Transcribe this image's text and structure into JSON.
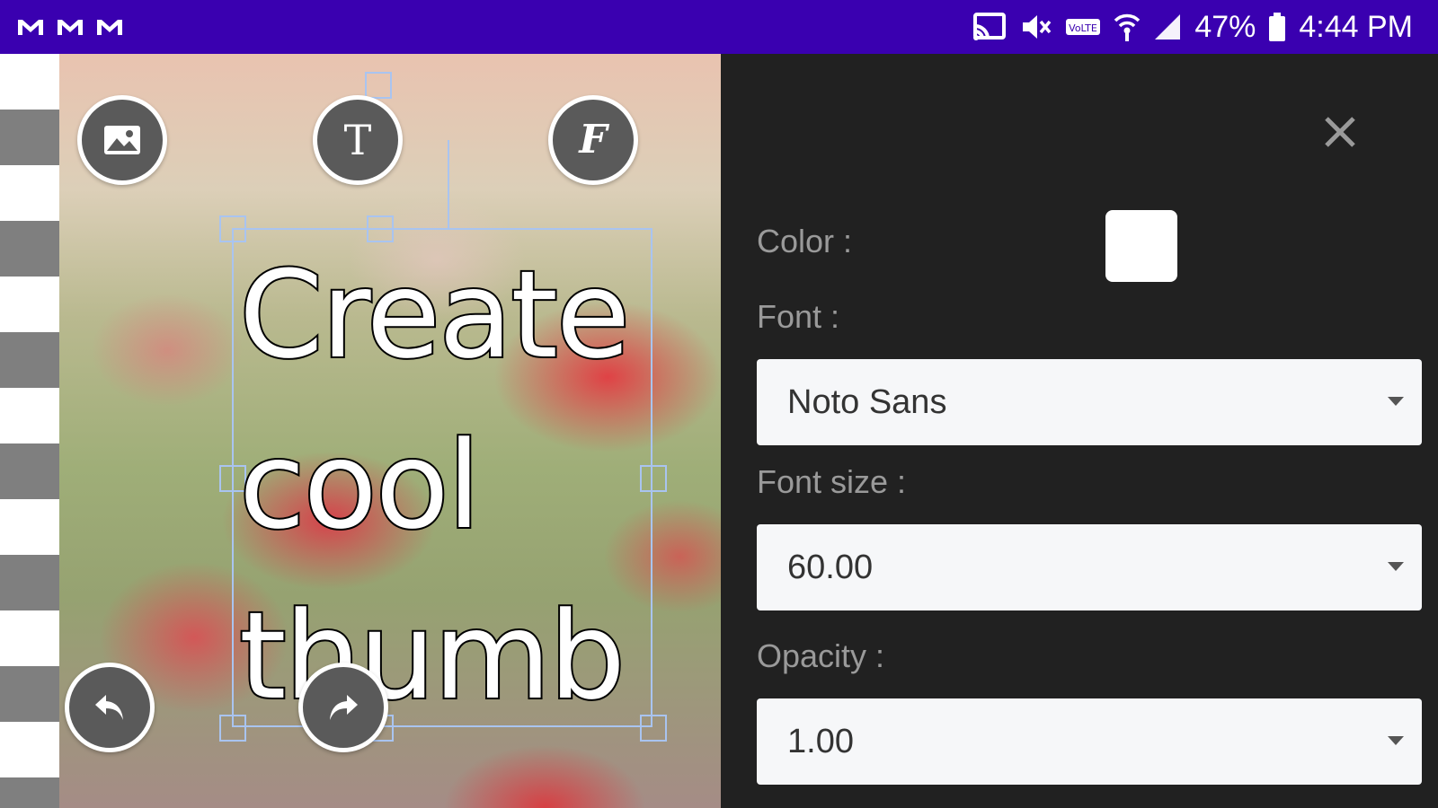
{
  "status_bar": {
    "notifications": [
      "gmail-icon",
      "gmail-icon",
      "gmail-icon"
    ],
    "icons": [
      "cast-icon",
      "mute-icon",
      "volte-icon",
      "wifi-icon",
      "signal-icon"
    ],
    "battery": "47%",
    "time": "4:44 PM"
  },
  "canvas": {
    "text": "Create\ncool\nthumb",
    "top_buttons": [
      "image-icon",
      "text-icon",
      "font-icon"
    ],
    "bottom_buttons": [
      "undo-icon",
      "redo-icon"
    ]
  },
  "panel": {
    "color_label": "Color :",
    "color_value": "#ffffff",
    "font_label": "Font :",
    "font_value": "Noto Sans",
    "font_size_label": "Font size :",
    "font_size_value": "60.00",
    "opacity_label": "Opacity :",
    "opacity_value": "1.00"
  },
  "colors": {
    "status_bar": "#3a00b0",
    "panel_bg": "#212121",
    "button_bg": "#5a5a5a",
    "selection": "#a9c4f0"
  }
}
